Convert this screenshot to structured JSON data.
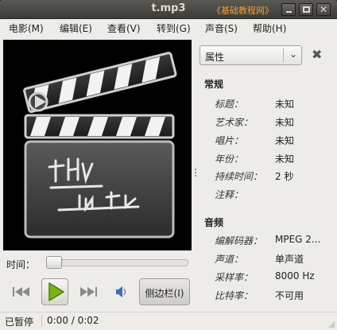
{
  "window": {
    "title": "t.mp3",
    "watermark": "《基础教程网》"
  },
  "menu": [
    "电影(M)",
    "编辑(E)",
    "查看(V)",
    "转到(G)",
    "声音(S)",
    "帮助(H)"
  ],
  "sidebar": {
    "selector_label": "属性",
    "general": {
      "heading": "常规",
      "rows": [
        {
          "label": "标题：",
          "value": "未知"
        },
        {
          "label": "艺术家：",
          "value": "未知"
        },
        {
          "label": "唱片：",
          "value": "未知"
        },
        {
          "label": "年份：",
          "value": "未知"
        },
        {
          "label": "持续时间：",
          "value": "2 秒"
        },
        {
          "label": "注释：",
          "value": ""
        }
      ]
    },
    "audio": {
      "heading": "音频",
      "rows": [
        {
          "label": "编解码器：",
          "value": "MPEG 2..."
        },
        {
          "label": "声道：",
          "value": "单声道"
        },
        {
          "label": "采样率：",
          "value": "8000 Hz"
        },
        {
          "label": "比特率：",
          "value": "不可用"
        }
      ]
    }
  },
  "playback": {
    "time_label": "时间：",
    "progress": 0,
    "sidebar_button": "侧边栏(I)"
  },
  "status": {
    "state": "已暂停",
    "time": "0:00 / 0:02"
  },
  "colors": {
    "play_green": "#7ab317",
    "watermark": "#f0a030"
  },
  "icons": {
    "media": "clapperboard-icon",
    "prev": "skip-back-icon",
    "play": "play-icon",
    "next": "skip-forward-icon",
    "volume": "volume-icon",
    "close": "close-icon"
  }
}
